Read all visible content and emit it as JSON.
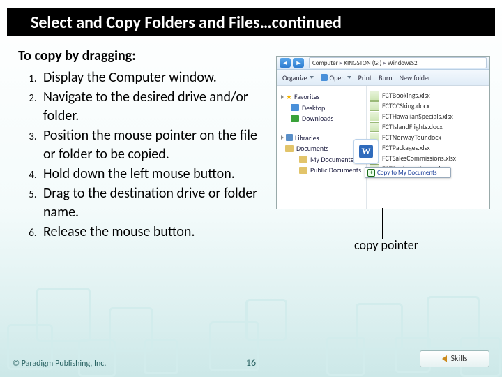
{
  "title": "Select and Copy Folders and Files…continued",
  "lead": "To copy by dragging:",
  "steps": [
    "Display the Computer window.",
    "Navigate to the desired drive and/or folder.",
    "Position the mouse pointer on the file or folder to be copied.",
    "Hold down the left mouse button.",
    "Drag to the destination drive or folder name.",
    "Release the mouse button."
  ],
  "explorer": {
    "breadcrumb": [
      "Computer",
      "KINGSTON (G:)",
      "WindowsS2"
    ],
    "toolbar": [
      "Organize",
      "Open",
      "Print",
      "Burn",
      "New folder"
    ],
    "nav": {
      "favorites": "Favorites",
      "libraries": "Libraries",
      "items": [
        "Desktop",
        "Downloads",
        "Documents",
        "My Documents",
        "Public Documents"
      ]
    },
    "files": [
      "FCTBookings.xlsx",
      "FCTCCSking.docx",
      "FCTHawaiianSpecials.xlsx",
      "FCTIslandFlights.docx",
      "FCTNorwayTour.docx",
      "FCTPackages.xlsx",
      "FCTSalesCommissions.xlsx",
      "FCTCostumeHours.xlsx"
    ],
    "drag_tip": "Copy to My Documents"
  },
  "callout": "copy pointer",
  "footer": {
    "copyright": "© Paradigm Publishing, Inc.",
    "page": "16",
    "skills": "Skills"
  }
}
